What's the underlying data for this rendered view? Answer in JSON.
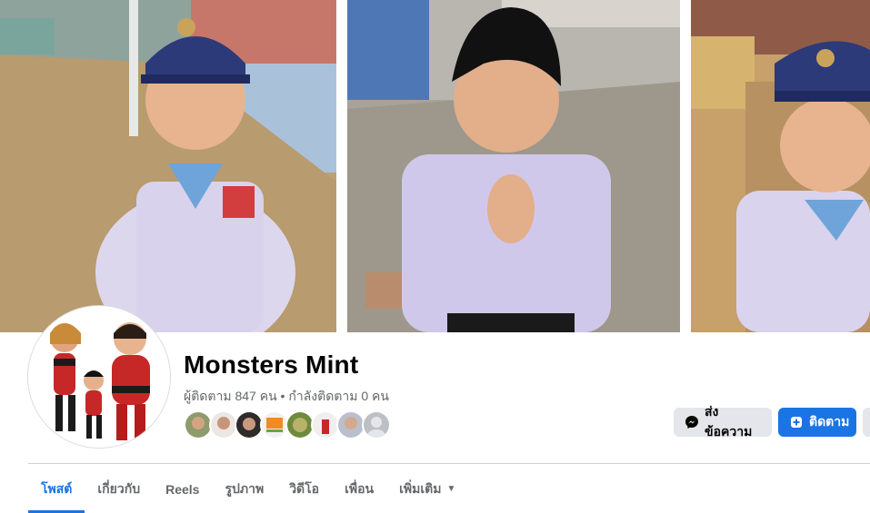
{
  "page": {
    "name": "Monsters Mint",
    "followers_text": "ผู้ติดตาม 847 คน",
    "separator": " • ",
    "following_text": "กำลังติดตาม 0 คน"
  },
  "actions": {
    "message_label": "ส่งข้อความ",
    "follow_label": "ติดตาม"
  },
  "tabs": [
    {
      "label": "โพสต์",
      "active": true
    },
    {
      "label": "เกี่ยวกับ",
      "active": false
    },
    {
      "label": "Reels",
      "active": false
    },
    {
      "label": "รูปภาพ",
      "active": false
    },
    {
      "label": "วิดีโอ",
      "active": false
    },
    {
      "label": "เพื่อน",
      "active": false
    },
    {
      "label": "เพิ่มเติม",
      "active": false
    }
  ],
  "colors": {
    "accent": "#1b74e4",
    "secondary_button": "#e4e6eb",
    "text_primary": "#050505",
    "text_secondary": "#65676b"
  },
  "icons": {
    "message": "messenger-icon",
    "follow": "follow-plus-icon",
    "more": "caret-down-icon"
  }
}
